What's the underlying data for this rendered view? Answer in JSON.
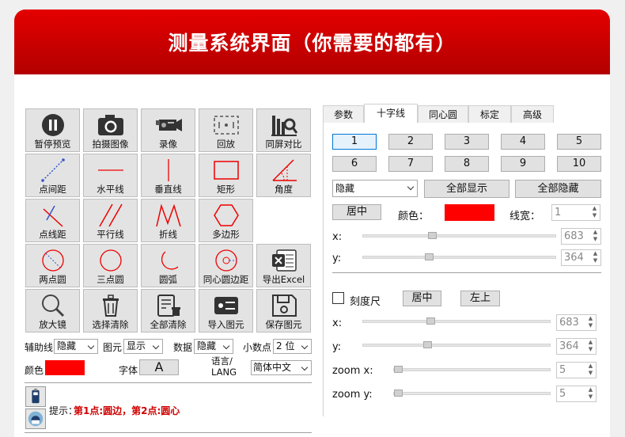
{
  "title": "测量系统界面（你需要的都有）",
  "toolbar": [
    {
      "label": "暂停预览",
      "icon": "pause-icon"
    },
    {
      "label": "拍摄图像",
      "icon": "camera-icon"
    },
    {
      "label": "录像",
      "icon": "video-camera-icon"
    },
    {
      "label": "回放",
      "icon": "playback-icon"
    },
    {
      "label": "同屏对比",
      "icon": "compare-icon"
    },
    {
      "label": "点间距",
      "icon": "point-distance-icon"
    },
    {
      "label": "水平线",
      "icon": "horizontal-line-icon"
    },
    {
      "label": "垂直线",
      "icon": "vertical-line-icon"
    },
    {
      "label": "矩形",
      "icon": "rectangle-icon"
    },
    {
      "label": "角度",
      "icon": "angle-icon"
    },
    {
      "label": "点线距",
      "icon": "point-line-distance-icon"
    },
    {
      "label": "平行线",
      "icon": "parallel-lines-icon"
    },
    {
      "label": "折线",
      "icon": "polyline-icon"
    },
    {
      "label": "多边形",
      "icon": "polygon-icon"
    },
    {
      "label": "两点圆",
      "icon": "two-point-circle-icon"
    },
    {
      "label": "三点圆",
      "icon": "three-point-circle-icon"
    },
    {
      "label": "圆弧",
      "icon": "arc-icon"
    },
    {
      "label": "同心圆边距",
      "icon": "concentric-circle-icon"
    },
    {
      "label": "导出Excel",
      "icon": "excel-icon"
    },
    {
      "label": "放大镜",
      "icon": "magnifier-icon"
    },
    {
      "label": "选择清除",
      "icon": "trash-icon"
    },
    {
      "label": "全部清除",
      "icon": "clear-all-icon"
    },
    {
      "label": "导入图元",
      "icon": "import-icon"
    },
    {
      "label": "保存图元",
      "icon": "save-icon"
    }
  ],
  "options": {
    "aux_label": "辅助线",
    "aux_value": "隐藏",
    "elem_label": "图元",
    "elem_value": "显示",
    "data_label": "数据",
    "data_value": "隐藏",
    "decimal_label": "小数点",
    "decimal_value": "2 位",
    "color_label": "颜色",
    "color": "#ff0000",
    "font_label": "字体",
    "font_glyph": "A",
    "lang_label": "语言/\nLANG",
    "lang_value": "简体中文"
  },
  "hint": {
    "prefix": "提示：",
    "text": "第1点:圆边，第2点:圆心"
  },
  "tabs": [
    "参数",
    "十字线",
    "同心圆",
    "标定",
    "高级"
  ],
  "active_tab": 1,
  "numbers": [
    "1",
    "2",
    "3",
    "4",
    "5",
    "6",
    "7",
    "8",
    "9",
    "10"
  ],
  "crosshair": {
    "mode_value": "隐藏",
    "show_all": "全部显示",
    "hide_all": "全部隐藏",
    "center": "居中",
    "color_label": "颜色：",
    "color": "#ff0000",
    "width_label": "线宽：",
    "width_value": "1",
    "x_label": "x:",
    "x_value": "683",
    "y_label": "y:",
    "y_value": "364"
  },
  "ruler": {
    "checkbox_label": "刻度尺",
    "center": "居中",
    "top_left": "左上",
    "x_label": "x:",
    "x_value": "683",
    "y_label": "y:",
    "y_value": "364",
    "zoomx_label": "zoom x:",
    "zoomx_value": "5",
    "zoomy_label": "zoom y:",
    "zoomy_value": "5"
  }
}
